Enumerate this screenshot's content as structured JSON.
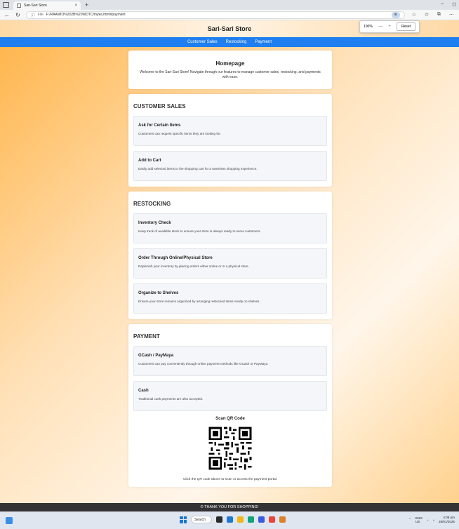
{
  "browser": {
    "tab_title": "Sari-Sari Store",
    "tab_close": "×",
    "new_tab": "+",
    "url_prefix": "File",
    "url": "F:/RAAMIO%202B%20WDTC/myka.html#payment",
    "zoom_percent": "100%",
    "zoom_minus": "—",
    "zoom_plus": "+",
    "zoom_reset": "Reset"
  },
  "site": {
    "title": "Sari-Sari Store",
    "nav": [
      "Customer Sales",
      "Restocking",
      "Payment"
    ],
    "home": {
      "heading": "Homepage",
      "text": "Welcome to the Sari-Sari Store! Navigate through our features to manage customer sales, restocking, and payments with ease."
    },
    "sections": {
      "customer_sales": {
        "title": "CUSTOMER SALES",
        "items": [
          {
            "title": "Ask for Certain Items",
            "text": "Customers can request specific items they are looking for."
          },
          {
            "title": "Add to Cart",
            "text": "Easily add selected items to the shopping cart for a seamless shopping experience."
          }
        ]
      },
      "restocking": {
        "title": "RESTOCKING",
        "items": [
          {
            "title": "Inventory Check",
            "text": "Keep track of available stock to ensure your store is always ready to serve customers."
          },
          {
            "title": "Order Through Online/Physical Store",
            "text": "Replenish your inventory by placing orders either online or in a physical store."
          },
          {
            "title": "Organize to Shelves",
            "text": "Ensure your store remains organized by arranging restocked items neatly on shelves."
          }
        ]
      },
      "payment": {
        "title": "PAYMENT",
        "items": [
          {
            "title": "GCash / PayMaya",
            "text": "Customers can pay conveniently through online payment methods like GCash or PayMaya."
          },
          {
            "title": "Cash",
            "text": "Traditional cash payments are also accepted."
          }
        ],
        "qr_title": "Scan QR Code",
        "qr_caption": "Click the QR code above to scan or access the payment portal."
      }
    },
    "footer": "© THANK YOU FOR SHOPPING!"
  },
  "taskbar": {
    "search_label": "Search",
    "lang": "ENG",
    "region": "US",
    "time": "4:08 pm",
    "date": "28/01/2025"
  },
  "colors": {
    "nav_bg": "#1f7ef0",
    "footer_bg": "#333333",
    "accent_orange": "#ffb347"
  }
}
